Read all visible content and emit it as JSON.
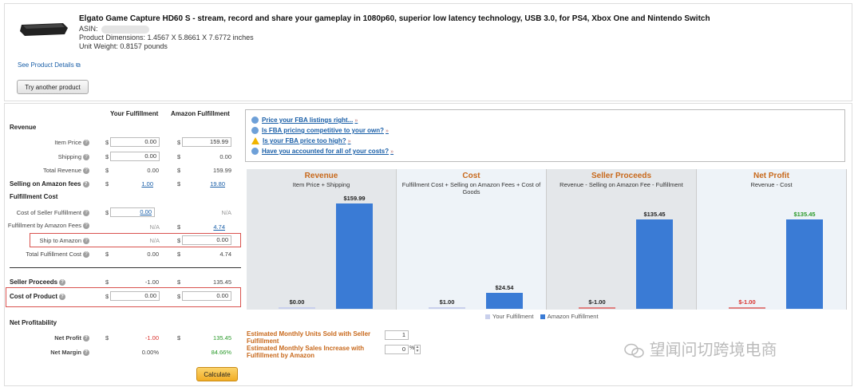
{
  "product": {
    "title": "Elgato Game Capture HD60 S - stream, record and share your gameplay in 1080p60, superior low latency technology, USB 3.0, for PS4, Xbox One and Nintendo Switch",
    "asin_label": "ASIN:",
    "dimensions": "Product Dimensions: 1.4567 X 5.8661 X 7.6772 inches",
    "weight": "Unit Weight: 0.8157 pounds",
    "details_link": "See Product Details",
    "try_button": "Try another product"
  },
  "calc": {
    "col_your": "Your Fulfillment",
    "col_amazon": "Amazon Fulfillment",
    "revenue_header": "Revenue",
    "item_price_label": "Item Price",
    "item_price_your": "0.00",
    "item_price_amazon": "159.99",
    "shipping_label": "Shipping",
    "shipping_your": "0.00",
    "shipping_amazon": "0.00",
    "total_revenue_label": "Total Revenue",
    "total_revenue_your": "0.00",
    "total_revenue_amazon": "159.99",
    "selling_fees_label": "Selling on Amazon fees",
    "selling_fees_your": "1.00",
    "selling_fees_amazon": "19.80",
    "fulfillment_header": "Fulfillment Cost",
    "seller_fulfillment_label": "Cost of Seller Fulfillment",
    "seller_fulfillment_your": "0.00",
    "seller_fulfillment_amazon": "N/A",
    "fba_fees_label": "Fulfillment by Amazon Fees",
    "fba_fees_your": "N/A",
    "fba_fees_amazon": "4.74",
    "ship_to_amazon_label": "Ship to Amazon",
    "ship_to_amazon_your": "N/A",
    "ship_to_amazon_amazon": "0.00",
    "total_fulfillment_label": "Total Fulfillment Cost",
    "total_fulfillment_your": "0.00",
    "total_fulfillment_amazon": "4.74",
    "seller_proceeds_label": "Seller Proceeds",
    "seller_proceeds_your": "-1.00",
    "seller_proceeds_amazon": "135.45",
    "cost_of_product_label": "Cost of Product",
    "cost_of_product_your": "0.00",
    "cost_of_product_amazon": "0.00",
    "net_profitability_header": "Net Profitability",
    "net_profit_label": "Net Profit",
    "net_profit_your": "-1.00",
    "net_profit_amazon": "135.45",
    "net_margin_label": "Net Margin",
    "net_margin_your": "0.00%",
    "net_margin_amazon": "84.66%",
    "currency": "$",
    "calculate_button": "Calculate"
  },
  "tips": [
    "Price your FBA listings right...",
    "Is FBA pricing competitive to your own?",
    "Is your FBA price too high?",
    "Have you accounted for all of your costs?"
  ],
  "chart": {
    "panels": [
      {
        "title": "Revenue",
        "subtitle": "Item Price + Shipping",
        "your_label": "$0.00",
        "amazon_label": "$159.99"
      },
      {
        "title": "Cost",
        "subtitle": "Fulfillment Cost + Selling on Amazon Fees + Cost of Goods",
        "your_label": "$1.00",
        "amazon_label": "$24.54"
      },
      {
        "title": "Seller Proceeds",
        "subtitle": "Revenue - Selling on Amazon Fee - Fulfillment",
        "your_label": "$-1.00",
        "amazon_label": "$135.45"
      },
      {
        "title": "Net Profit",
        "subtitle": "Revenue - Cost",
        "your_label": "$-1.00",
        "amazon_label": "$135.45"
      }
    ],
    "legend_your": "Your Fulfillment",
    "legend_amazon": "Amazon Fulfillment",
    "colors": {
      "your": "#c9d0ec",
      "amazon": "#3a7bd5"
    }
  },
  "chart_data": {
    "type": "bar",
    "categories": [
      "Revenue",
      "Cost",
      "Seller Proceeds",
      "Net Profit"
    ],
    "series": [
      {
        "name": "Your Fulfillment",
        "values": [
          0.0,
          1.0,
          -1.0,
          -1.0
        ]
      },
      {
        "name": "Amazon Fulfillment",
        "values": [
          159.99,
          24.54,
          135.45,
          135.45
        ]
      }
    ]
  },
  "estimates": {
    "units_label": "Estimated Monthly Units Sold with Seller Fulfillment",
    "units_value": "1",
    "increase_label": "Estimated Monthly Sales Increase with Fulfillment by Amazon",
    "increase_value": "0",
    "increase_unit": "%"
  },
  "watermark": "望闻问切跨境电商"
}
